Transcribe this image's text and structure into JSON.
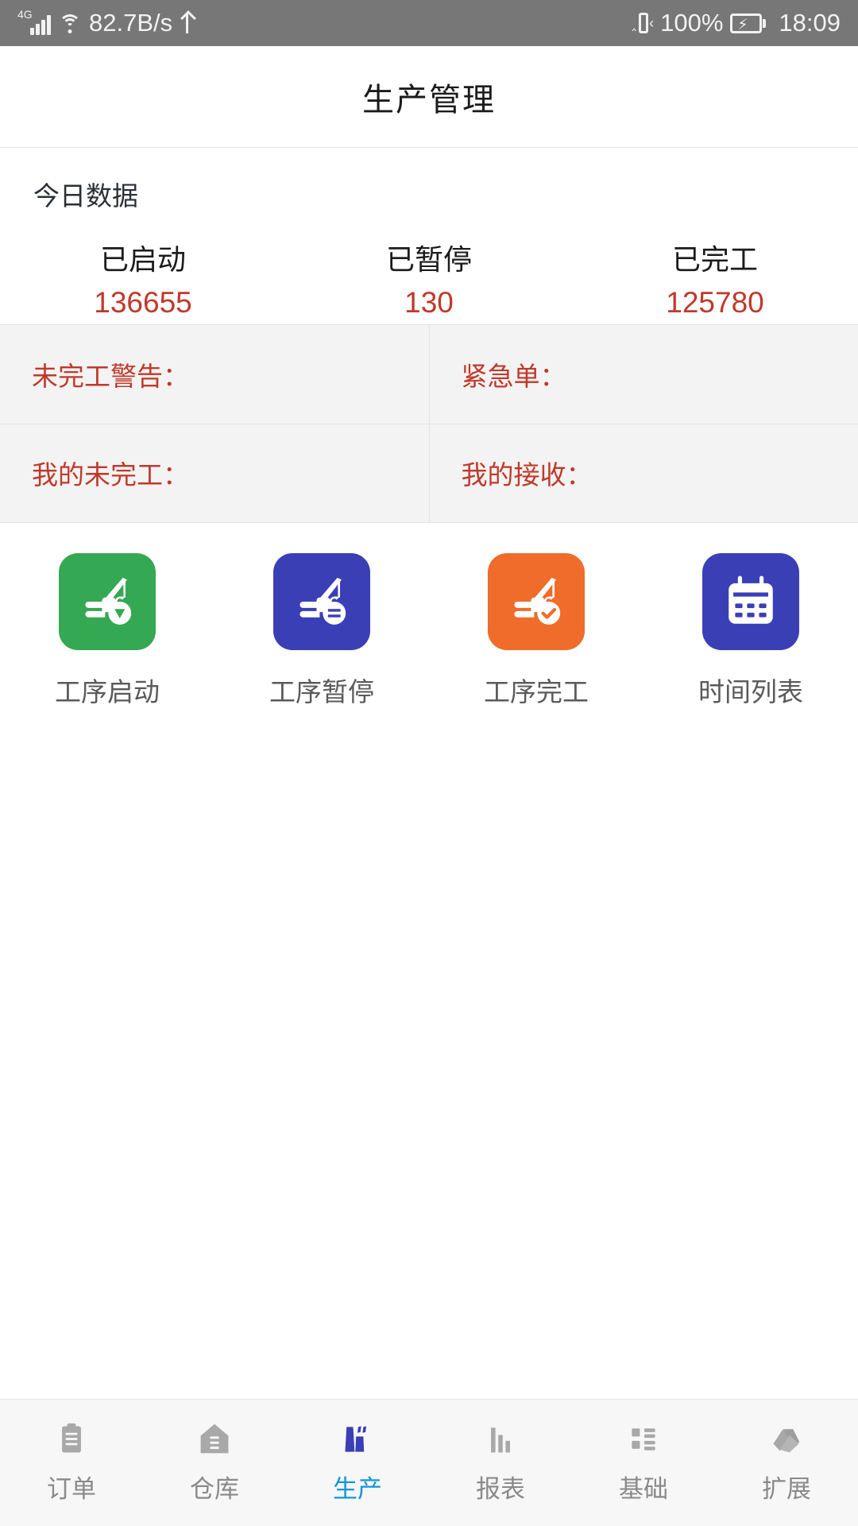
{
  "status_bar": {
    "network_type": "4G",
    "speed": "82.7B/s",
    "battery_percent": "100%",
    "time": "18:09",
    "icons": [
      "signal-icon",
      "wifi-icon",
      "usb-icon",
      "vibrate-icon",
      "battery-charging-icon"
    ]
  },
  "header": {
    "title": "生产管理"
  },
  "today": {
    "section_title": "今日数据",
    "stats": [
      {
        "label": "已启动",
        "value": "136655"
      },
      {
        "label": "已暂停",
        "value": "130"
      },
      {
        "label": "已完工",
        "value": "125780"
      }
    ],
    "value_color": "#c0392b"
  },
  "warnings": {
    "cells": [
      {
        "label": "未完工警告：",
        "value": ""
      },
      {
        "label": "紧急单：",
        "value": ""
      },
      {
        "label": "我的未完工：",
        "value": ""
      },
      {
        "label": "我的接收：",
        "value": ""
      }
    ],
    "text_color": "#c0392b",
    "background": "#f3f3f3"
  },
  "shortcuts": [
    {
      "label": "工序启动",
      "icon": "crane-play-icon",
      "color": "#34a853"
    },
    {
      "label": "工序暂停",
      "icon": "crane-pause-icon",
      "color": "#3b3fb5"
    },
    {
      "label": "工序完工",
      "icon": "crane-check-icon",
      "color": "#ef6c2a"
    },
    {
      "label": "时间列表",
      "icon": "calendar-icon",
      "color": "#3b3fb5"
    }
  ],
  "bottom_nav": {
    "active_color": "#1296db",
    "inactive_color": "#8a8a8a",
    "items": [
      {
        "label": "订单",
        "icon": "clipboard-icon",
        "active": false
      },
      {
        "label": "仓库",
        "icon": "warehouse-icon",
        "active": false
      },
      {
        "label": "生产",
        "icon": "factory-icon",
        "active": true
      },
      {
        "label": "报表",
        "icon": "bar-chart-icon",
        "active": false
      },
      {
        "label": "基础",
        "icon": "grid-list-icon",
        "active": false
      },
      {
        "label": "扩展",
        "icon": "layers-icon",
        "active": false
      }
    ]
  }
}
